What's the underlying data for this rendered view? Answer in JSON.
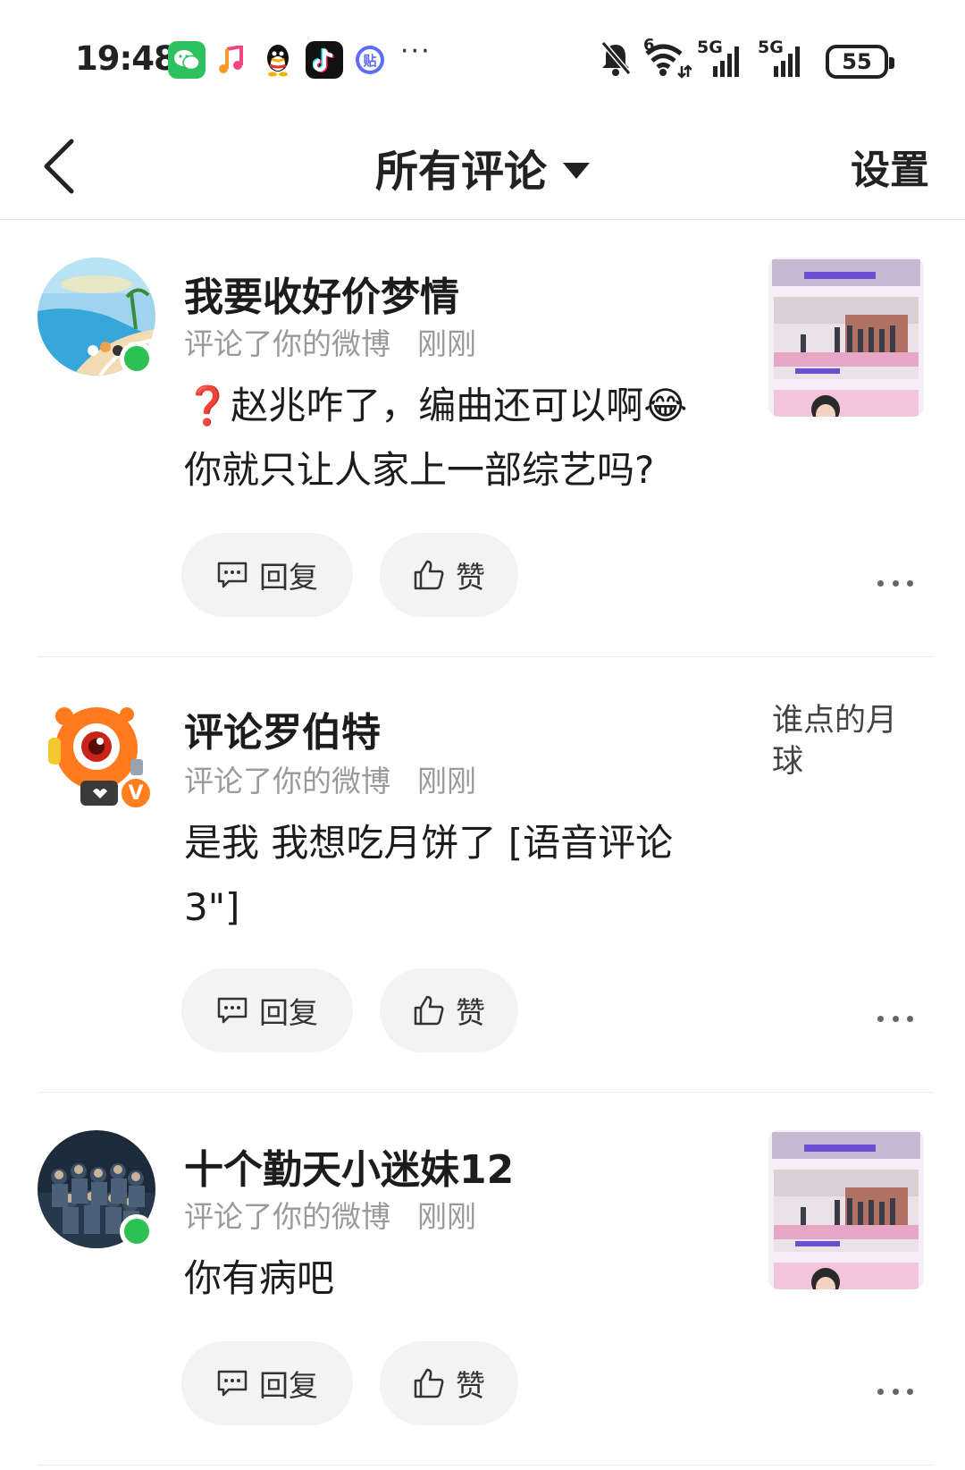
{
  "status_bar": {
    "time": "19:48",
    "apps": [
      "wechat-icon",
      "music-icon",
      "qq-icon",
      "tiktok-icon",
      "tieba-icon"
    ],
    "more": "···",
    "signal_1": "5G",
    "signal_2": "5G",
    "wifi_label": "6",
    "battery": "55"
  },
  "nav": {
    "title": "所有评论",
    "settings": "设置"
  },
  "comments": [
    {
      "user": "我要收好价梦情",
      "action": "评论了你的微博",
      "time": "刚刚",
      "lines": [
        "❓赵兆咋了，编曲还可以啊😂",
        "你就只让人家上一部综艺吗?"
      ],
      "reply_label": "回复",
      "like_label": "赞"
    },
    {
      "user": "评论罗伯特",
      "action": "评论了你的微博",
      "time": "刚刚",
      "lines": [
        "是我 我想吃月饼了 [语音评论",
        "3\"]"
      ],
      "side_text": "谁点的月球",
      "reply_label": "回复",
      "like_label": "赞"
    },
    {
      "user": "十个勤天小迷妹12",
      "action": "评论了你的微博",
      "time": "刚刚",
      "lines": [
        "你有病吧"
      ],
      "reply_label": "回复",
      "like_label": "赞"
    }
  ]
}
